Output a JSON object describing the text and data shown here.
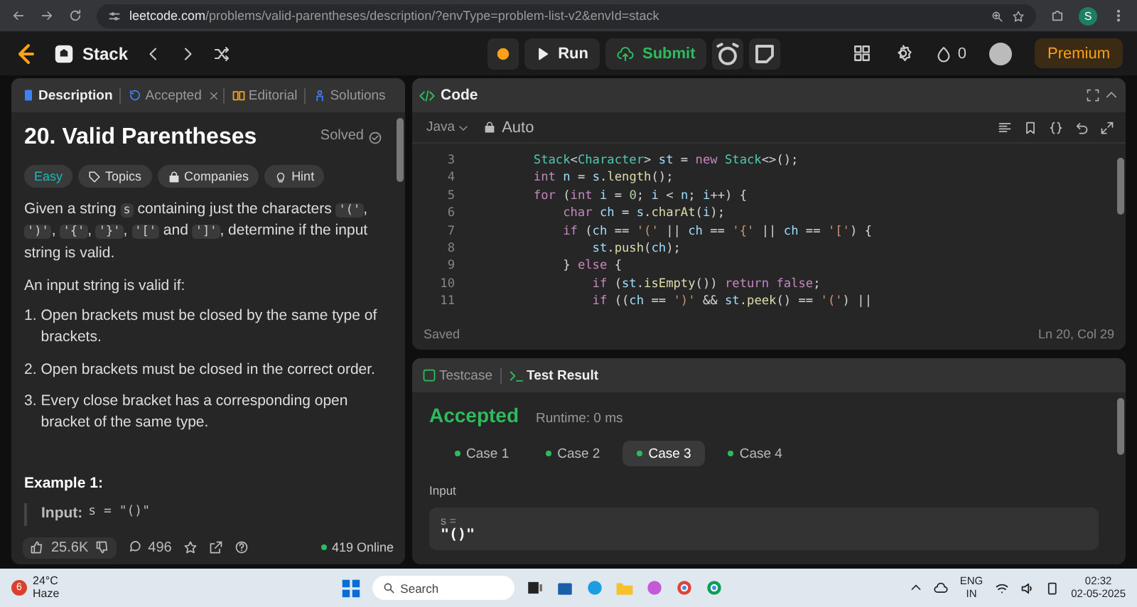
{
  "browser": {
    "url_host": "leetcode.com",
    "url_path": "/problems/valid-parentheses/description/?envType=problem-list-v2&envId=stack",
    "profile": "S"
  },
  "nav": {
    "list_name": "Stack",
    "run": "Run",
    "submit": "Submit",
    "streak": "0",
    "premium": "Premium"
  },
  "description_tabs": [
    {
      "label": "Description",
      "selected": true,
      "closable": false
    },
    {
      "label": "Accepted",
      "selected": false,
      "closable": true
    },
    {
      "label": "Editorial",
      "selected": false,
      "closable": false
    },
    {
      "label": "Solutions",
      "selected": false,
      "closable": false
    }
  ],
  "problem": {
    "title": "20. Valid Parentheses",
    "status": "Solved",
    "difficulty": "Easy",
    "tags": [
      "Topics",
      "Companies",
      "Hint"
    ],
    "paragraph": [
      {
        "kind": "text",
        "text": "Given a string "
      },
      {
        "kind": "code",
        "text": "s"
      },
      {
        "kind": "text",
        "text": " containing just the characters "
      },
      {
        "kind": "code",
        "text": "'('"
      },
      {
        "kind": "text",
        "text": ", "
      },
      {
        "kind": "code",
        "text": "')'"
      },
      {
        "kind": "text",
        "text": ", "
      },
      {
        "kind": "code",
        "text": "'{'"
      },
      {
        "kind": "text",
        "text": ", "
      },
      {
        "kind": "code",
        "text": "'}'"
      },
      {
        "kind": "text",
        "text": ", "
      },
      {
        "kind": "code",
        "text": "'['"
      },
      {
        "kind": "text",
        "text": " and "
      },
      {
        "kind": "code",
        "text": "']'"
      },
      {
        "kind": "text",
        "text": ", determine if the input string is valid."
      }
    ],
    "intro": "An input string is valid if:",
    "rules": [
      {
        "marker": "1.",
        "text": "Open brackets must be closed by the same type of brackets."
      },
      {
        "marker": "2.",
        "text": "Open brackets must be closed in the correct order."
      },
      {
        "marker": "3.",
        "text": "Every close bracket has a corresponding open bracket of the same type."
      }
    ],
    "example_heading": "Example 1:",
    "example_label": "Input:",
    "example_value": "s = \"()\""
  },
  "footer": {
    "likes": "25.6K",
    "comments": "496",
    "online": "419 Online"
  },
  "code_panel": {
    "title": "Code",
    "language": "Java",
    "mode": "Auto",
    "status": "Saved",
    "cursor": "Ln 20, Col 29",
    "lines": [
      {
        "number": "3",
        "tokens": [
          {
            "kind": "type",
            "text": "        Stack"
          },
          {
            "kind": "p",
            "text": "<"
          },
          {
            "kind": "type",
            "text": "Character"
          },
          {
            "kind": "p",
            "text": "> "
          },
          {
            "kind": "var",
            "text": "st"
          },
          {
            "kind": "p",
            "text": " = "
          },
          {
            "kind": "kw",
            "text": "new "
          },
          {
            "kind": "type",
            "text": "Stack"
          },
          {
            "kind": "p",
            "text": "<>();"
          }
        ]
      },
      {
        "number": "4",
        "tokens": [
          {
            "kind": "kw",
            "text": "        int "
          },
          {
            "kind": "var",
            "text": "n"
          },
          {
            "kind": "p",
            "text": " = "
          },
          {
            "kind": "var",
            "text": "s"
          },
          {
            "kind": "p",
            "text": "."
          },
          {
            "kind": "fn",
            "text": "length"
          },
          {
            "kind": "p",
            "text": "();"
          }
        ]
      },
      {
        "number": "5",
        "tokens": [
          {
            "kind": "kw",
            "text": "        for"
          },
          {
            "kind": "p",
            "text": " ("
          },
          {
            "kind": "kw",
            "text": "int "
          },
          {
            "kind": "var",
            "text": "i"
          },
          {
            "kind": "p",
            "text": " = "
          },
          {
            "kind": "num",
            "text": "0"
          },
          {
            "kind": "p",
            "text": "; "
          },
          {
            "kind": "var",
            "text": "i"
          },
          {
            "kind": "p",
            "text": " < "
          },
          {
            "kind": "var",
            "text": "n"
          },
          {
            "kind": "p",
            "text": "; "
          },
          {
            "kind": "var",
            "text": "i"
          },
          {
            "kind": "p",
            "text": "++) {"
          }
        ]
      },
      {
        "number": "6",
        "tokens": [
          {
            "kind": "kw",
            "text": "            char "
          },
          {
            "kind": "var",
            "text": "ch"
          },
          {
            "kind": "p",
            "text": " = "
          },
          {
            "kind": "var",
            "text": "s"
          },
          {
            "kind": "p",
            "text": "."
          },
          {
            "kind": "fn",
            "text": "charAt"
          },
          {
            "kind": "p",
            "text": "("
          },
          {
            "kind": "var",
            "text": "i"
          },
          {
            "kind": "p",
            "text": ");"
          }
        ]
      },
      {
        "number": "7",
        "tokens": [
          {
            "kind": "kw",
            "text": "            if"
          },
          {
            "kind": "p",
            "text": " ("
          },
          {
            "kind": "var",
            "text": "ch"
          },
          {
            "kind": "p",
            "text": " == "
          },
          {
            "kind": "str",
            "text": "'('"
          },
          {
            "kind": "p",
            "text": " || "
          },
          {
            "kind": "var",
            "text": "ch"
          },
          {
            "kind": "p",
            "text": " == "
          },
          {
            "kind": "str",
            "text": "'{'"
          },
          {
            "kind": "p",
            "text": " || "
          },
          {
            "kind": "var",
            "text": "ch"
          },
          {
            "kind": "p",
            "text": " == "
          },
          {
            "kind": "str",
            "text": "'['"
          },
          {
            "kind": "p",
            "text": ") {"
          }
        ]
      },
      {
        "number": "8",
        "tokens": [
          {
            "kind": "var",
            "text": "                st"
          },
          {
            "kind": "p",
            "text": "."
          },
          {
            "kind": "fn",
            "text": "push"
          },
          {
            "kind": "p",
            "text": "("
          },
          {
            "kind": "var",
            "text": "ch"
          },
          {
            "kind": "p",
            "text": ");"
          }
        ]
      },
      {
        "number": "9",
        "tokens": [
          {
            "kind": "p",
            "text": "            } "
          },
          {
            "kind": "kw",
            "text": "else"
          },
          {
            "kind": "p",
            "text": " {"
          }
        ]
      },
      {
        "number": "10",
        "tokens": [
          {
            "kind": "kw",
            "text": "                if"
          },
          {
            "kind": "p",
            "text": " ("
          },
          {
            "kind": "var",
            "text": "st"
          },
          {
            "kind": "p",
            "text": "."
          },
          {
            "kind": "fn",
            "text": "isEmpty"
          },
          {
            "kind": "p",
            "text": "()) "
          },
          {
            "kind": "kw",
            "text": "return "
          },
          {
            "kind": "kw",
            "text": "false"
          },
          {
            "kind": "p",
            "text": ";"
          }
        ]
      },
      {
        "number": "11",
        "tokens": [
          {
            "kind": "kw",
            "text": "                if"
          },
          {
            "kind": "p",
            "text": " (("
          },
          {
            "kind": "var",
            "text": "ch"
          },
          {
            "kind": "p",
            "text": " == "
          },
          {
            "kind": "str",
            "text": "')'"
          },
          {
            "kind": "p",
            "text": " && "
          },
          {
            "kind": "var",
            "text": "st"
          },
          {
            "kind": "p",
            "text": "."
          },
          {
            "kind": "fn",
            "text": "peek"
          },
          {
            "kind": "p",
            "text": "() == "
          },
          {
            "kind": "str",
            "text": "'('"
          },
          {
            "kind": "p",
            "text": ") ||"
          }
        ]
      }
    ]
  },
  "result_tabs": [
    {
      "label": "Testcase",
      "selected": false
    },
    {
      "label": "Test Result",
      "selected": true
    }
  ],
  "result": {
    "verdict": "Accepted",
    "runtime": "Runtime: 0 ms",
    "cases": [
      {
        "label": "Case 1",
        "selected": false
      },
      {
        "label": "Case 2",
        "selected": false
      },
      {
        "label": "Case 3",
        "selected": true
      },
      {
        "label": "Case 4",
        "selected": false
      }
    ],
    "input_label": "Input",
    "var_name": "s =",
    "var_value": "\"()\""
  },
  "taskbar": {
    "weather_badge": "6",
    "temperature": "24°C",
    "weather": "Haze",
    "search_placeholder": "Search",
    "language": "ENG",
    "region": "IN",
    "time": "02:32",
    "date": "02-05-2025"
  }
}
